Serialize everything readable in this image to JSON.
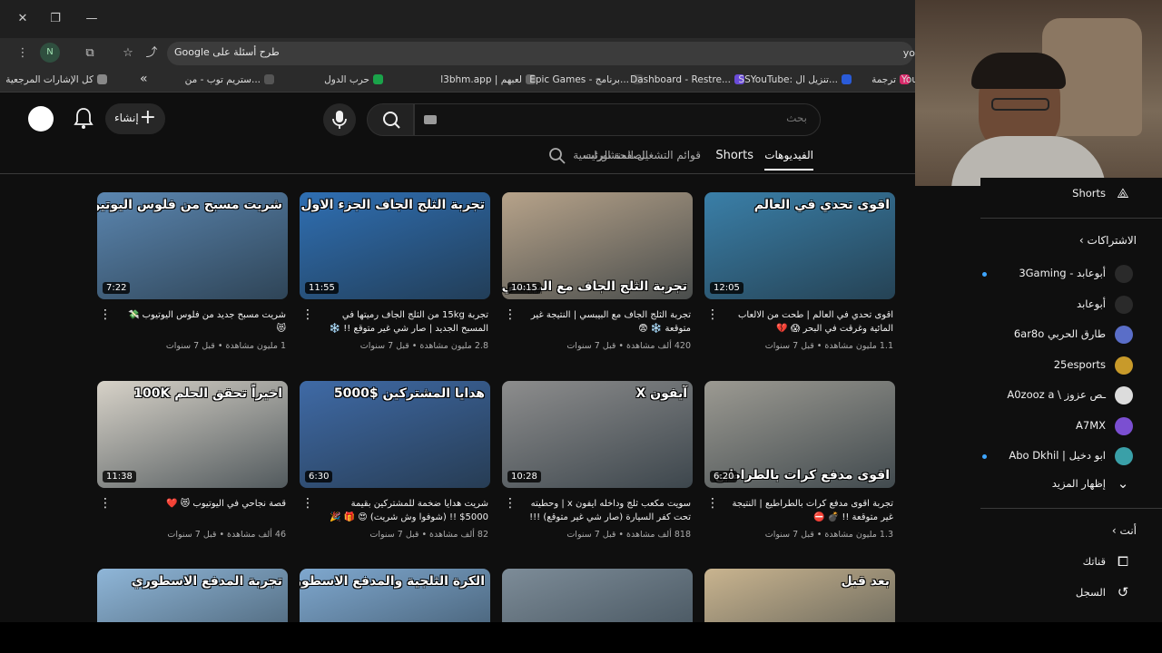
{
  "browser": {
    "omnibox_text": "طرح أسئلة على Google",
    "right_edge_text": "yo",
    "bookmarks": [
      {
        "label": "كل الإشارات المرجعية",
        "color": "#888"
      },
      {
        "label": "ستريم توب - من...",
        "color": "#555"
      },
      {
        "label": "حرب الدول",
        "color": "#1aa34a"
      },
      {
        "label": "l3bhm.app | لعبهم",
        "color": "#666"
      },
      {
        "label": "Epic Games - برنامج...",
        "color": "#444"
      },
      {
        "label": "Dashboard - Restre...",
        "color": "#6a4bd8"
      },
      {
        "label": "SSYouTube: تنزيل ال...",
        "color": "#2a5bd8"
      },
      {
        "label": "ترجمة",
        "color": "#d82a6a"
      },
      {
        "label": "You",
        "color": "#4285f4"
      }
    ]
  },
  "header": {
    "create_label": "إنشاء",
    "search_placeholder": "بحث"
  },
  "tabs": [
    {
      "label": "الصفحة الرئيسية",
      "active": false
    },
    {
      "label": "الفيديوهات",
      "active": true
    },
    {
      "label": "Shorts",
      "active": false
    },
    {
      "label": "قوائم التشغيل",
      "active": false
    },
    {
      "label": "المنشورات",
      "active": false
    }
  ],
  "videos": [
    {
      "thumb_text": "اقوى تحدي في العالم",
      "duration": "12:05",
      "title": "اقوى تحدي في العالم | طحت من الالعاب المائية وغرقت في البحر 😱 💔",
      "meta": "1.1 مليون مشاهدة • قبل 7 سنوات",
      "bg": "#3a7fa8"
    },
    {
      "thumb_text": "تجربة الثلج الجاف مع البيبسي",
      "duration": "10:15",
      "title": "تجربة الثلج الجاف مع البيبسي | النتيجة غير متوقعة ❄️ 😨",
      "meta": "420 ألف مشاهدة • قبل 7 سنوات",
      "bg": "#b7a38a"
    },
    {
      "thumb_text": "تجربة الثلج الجاف الجزء الاول",
      "duration": "11:55",
      "title": "تجربة 15kg من الثلج الجاف رميتها في المسبح الجديد | صار شي غير متوقع !! ❄️ 😮 #1",
      "meta": "2.8 مليون مشاهدة • قبل 7 سنوات",
      "bg": "#2f6fb3"
    },
    {
      "thumb_text": "شريت مسبح من فلوس اليوتيوب",
      "duration": "7:22",
      "title": "شريت مسبح جديد من فلوس اليوتيوب 💸 😻",
      "meta": "1 مليون مشاهدة • قبل 7 سنوات",
      "bg": "#5b86b0"
    },
    {
      "thumb_text": "اقوى مدفع كرات بالطراطيع",
      "duration": "6:20",
      "title": "تجربة اقوى مدفع كرات بالطراطيع | النتيجة غير متوقعة !! 💣 ⛔",
      "meta": "1.3 مليون مشاهدة • قبل 7 سنوات",
      "bg": "#9c9a92"
    },
    {
      "thumb_text": "آيفون X",
      "duration": "10:28",
      "title": "سويت مكعب ثلج وداخله ايفون x | وحطيته تحت كفر السيارة (صار شي غير متوقع) !!! ❄️ 😮",
      "meta": "818 ألف مشاهدة • قبل 7 سنوات",
      "bg": "#8d8d8d"
    },
    {
      "thumb_text": "هدايا المشتركين $5000",
      "duration": "6:30",
      "title": "شريت هدايا ضخمة للمشتركين بقيمة 5000$ !! (شوفوا وش شريت) 😍 🎁 🎉",
      "meta": "82 ألف مشاهدة • قبل 7 سنوات",
      "bg": "#3f6aa6"
    },
    {
      "thumb_text": "اخيراً تحقق الحلم 100K",
      "duration": "11:38",
      "title": "قصة نجاحي في اليوتيوب 😻 ❤️",
      "meta": "46 ألف مشاهدة • قبل 7 سنوات",
      "bg": "#d7d2c8"
    },
    {
      "thumb_text": "بعد قبل",
      "duration": "",
      "title": "",
      "meta": "",
      "bg": "#c9b48f"
    },
    {
      "thumb_text": "",
      "duration": "",
      "title": "",
      "meta": "",
      "bg": "#7d8c98"
    },
    {
      "thumb_text": "الكرة الثلجية والمدفع الاسطوري",
      "duration": "",
      "title": "",
      "meta": "",
      "bg": "#7fa8cf"
    },
    {
      "thumb_text": "تجربة المدفع الاسطوري",
      "duration": "",
      "title": "",
      "meta": "",
      "bg": "#8fb6d8"
    }
  ],
  "sidebar": {
    "shorts_label": "Shorts",
    "subscriptions_heading": "الاشتراكات",
    "subscriptions": [
      {
        "label": "أبوعابد - 3Gaming",
        "color": "#2a2a2a",
        "dot": true
      },
      {
        "label": "أبوعابد",
        "color": "#2a2a2a",
        "dot": false
      },
      {
        "label": "طارق الحربي 6ar8o",
        "color": "#5a6ec8",
        "dot": false
      },
      {
        "label": "25esports",
        "color": "#c89a2a",
        "dot": false
      },
      {
        "label": "ـص عزوز \\ A0zooz a",
        "color": "#dcdcdc",
        "dot": false
      },
      {
        "label": "A7MX",
        "color": "#7b4fd1",
        "dot": false
      },
      {
        "label": "ابو دخيل | Abo Dkhil",
        "color": "#3aa0a8",
        "dot": true
      }
    ],
    "show_more_label": "إظهار المزيد",
    "you_heading": "أنت",
    "you_items": [
      {
        "label": "قناتك",
        "icon": "channel-icon"
      },
      {
        "label": "السجل",
        "icon": "history-icon"
      }
    ]
  }
}
